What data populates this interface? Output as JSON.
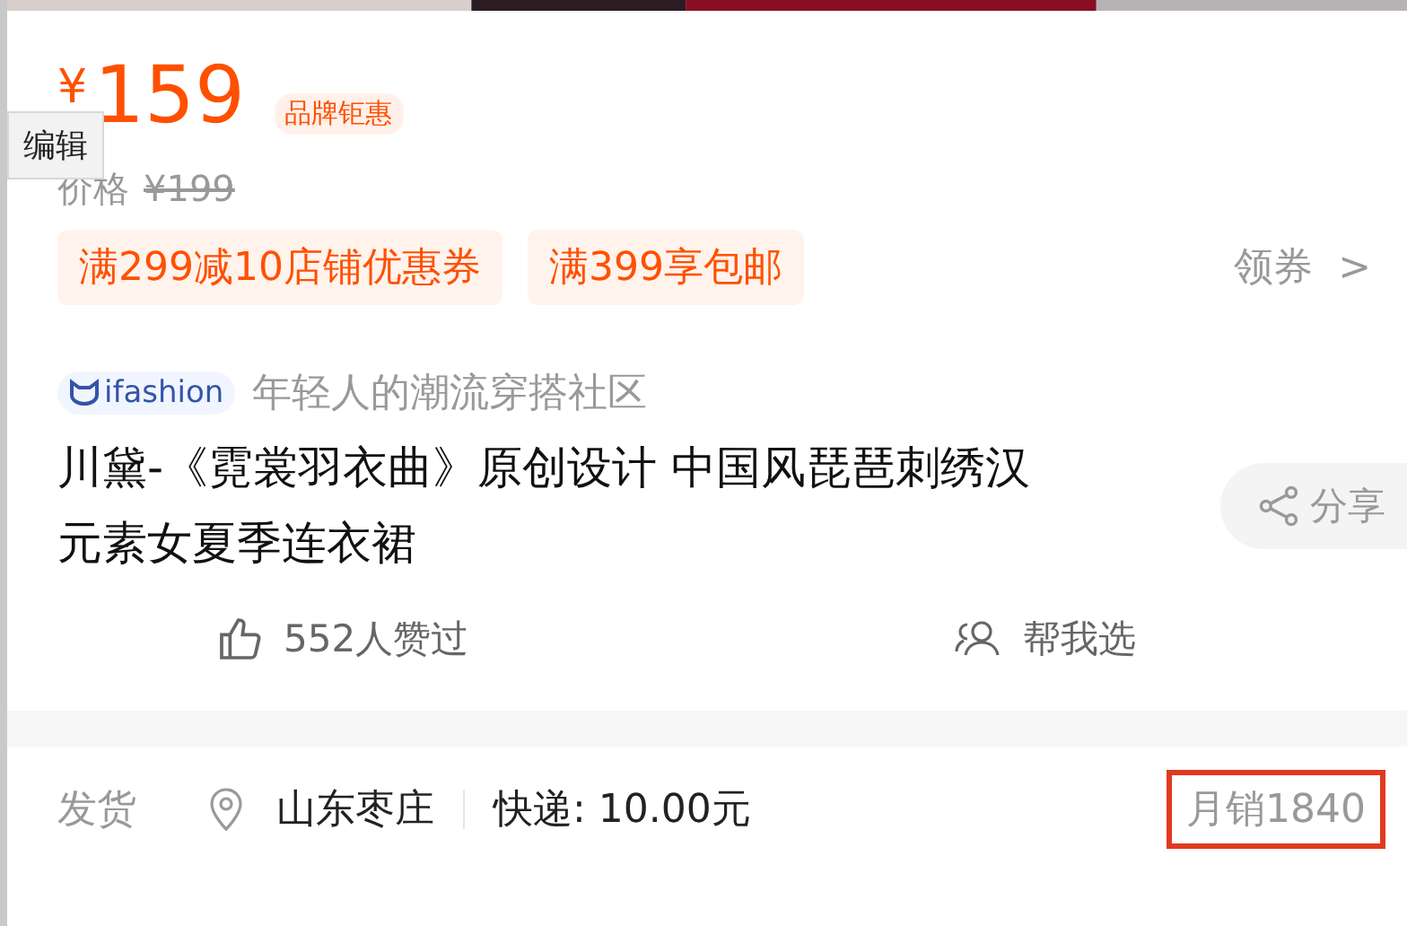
{
  "tooltip": {
    "label": "编辑"
  },
  "price": {
    "currency": "¥",
    "amount": "159",
    "badge": "品牌钜惠"
  },
  "original_price": {
    "label": "价格",
    "value": "¥199"
  },
  "coupons": [
    {
      "label": "满299减10店铺优惠券"
    },
    {
      "label": "满399享包邮"
    }
  ],
  "coupon_link": {
    "label": "领券",
    "arrow": ">"
  },
  "brand": {
    "logo_text": "ifashion",
    "slogan": "年轻人的潮流穿搭社区"
  },
  "title": "川黛-《霓裳羽衣曲》原创设计 中国风琵琶刺绣汉元素女夏季连衣裙",
  "share": {
    "label": "分享"
  },
  "actions": [
    {
      "kind": "like",
      "label": "552人赞过"
    },
    {
      "kind": "help",
      "label": "帮我选"
    }
  ],
  "shipping": {
    "label": "发货",
    "location": "山东枣庄",
    "express": "快递: 10.00元",
    "monthly_sales": "月销1840",
    "highlighted": true
  }
}
